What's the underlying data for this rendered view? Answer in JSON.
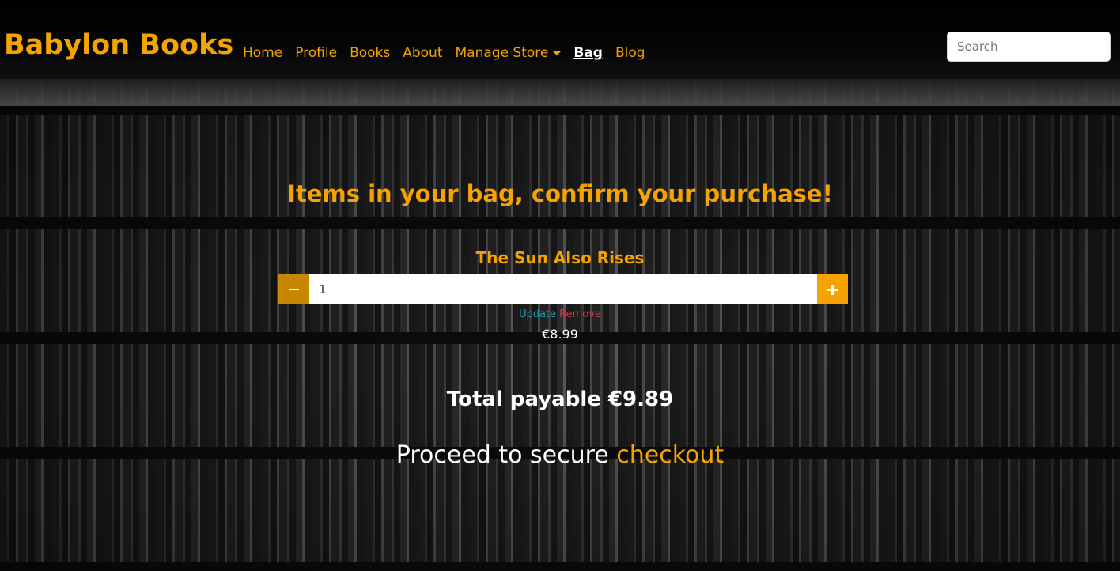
{
  "brand": "Babylon Books",
  "nav": {
    "items": [
      {
        "label": "Home",
        "active": false
      },
      {
        "label": "Profile",
        "active": false
      },
      {
        "label": "Books",
        "active": false
      },
      {
        "label": "About",
        "active": false
      },
      {
        "label": "Manage Store",
        "active": false,
        "dropdown": true
      },
      {
        "label": "Bag",
        "active": true
      },
      {
        "label": "Blog",
        "active": false
      }
    ]
  },
  "search": {
    "placeholder": "Search",
    "value": ""
  },
  "main": {
    "heading": "Items in your bag, confirm your purchase!",
    "item": {
      "title": "The Sun Also Rises",
      "quantity": "1",
      "update_label": "Update",
      "remove_label": "Remove",
      "price": "€8.99"
    },
    "total": "Total payable €9.89",
    "checkout_prefix": "Proceed to secure ",
    "checkout_link": "checkout"
  },
  "colors": {
    "accent": "#f5a300",
    "update": "#17a2b8",
    "remove": "#dc3545",
    "text": "#ffffff"
  },
  "icons": {
    "decrement": "minus-icon",
    "increment": "plus-icon",
    "dropdown": "caret-down-icon"
  }
}
